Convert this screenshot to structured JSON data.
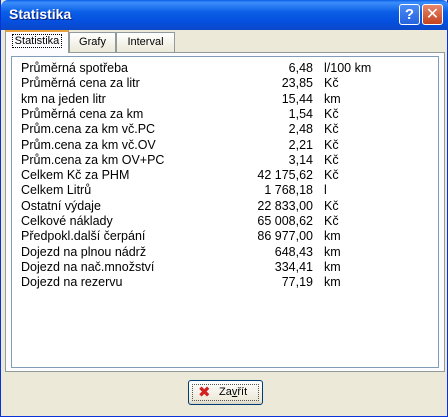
{
  "window": {
    "title": "Statistika"
  },
  "tabs": [
    {
      "label": "Statistika",
      "active": true
    },
    {
      "label": "Grafy",
      "active": false
    },
    {
      "label": "Interval",
      "active": false
    }
  ],
  "stats": [
    {
      "label": "Průměrná spotřeba",
      "value": "6,48",
      "unit": "l/100 km"
    },
    {
      "label": "Průměrná cena za litr",
      "value": "23,85",
      "unit": "Kč"
    },
    {
      "label": "km na jeden litr",
      "value": "15,44",
      "unit": "km"
    },
    {
      "label": "Průměrná cena za km",
      "value": "1,54",
      "unit": "Kč"
    },
    {
      "label": "Prům.cena za km vč.PC",
      "value": "2,48",
      "unit": "Kč"
    },
    {
      "label": "Prům.cena za km vč.OV",
      "value": "2,21",
      "unit": "Kč"
    },
    {
      "label": "Prům.cena za km OV+PC",
      "value": "3,14",
      "unit": "Kč"
    },
    {
      "label": "Celkem Kč za PHM",
      "value": "42 175,62",
      "unit": "Kč"
    },
    {
      "label": "Celkem Litrů",
      "value": "1 768,18",
      "unit": "l"
    },
    {
      "label": "Ostatní výdaje",
      "value": "22 833,00",
      "unit": "Kč"
    },
    {
      "label": "Celkové náklady",
      "value": "65 008,62",
      "unit": "Kč"
    },
    {
      "label": "Předpokl.další čerpání",
      "value": "86 977,00",
      "unit": "km"
    },
    {
      "label": "Dojezd na plnou nádrž",
      "value": "648,43",
      "unit": "km"
    },
    {
      "label": "Dojezd na nač.množství",
      "value": "334,41",
      "unit": "km"
    },
    {
      "label": "Dojezd na rezervu",
      "value": "77,19",
      "unit": "km"
    }
  ],
  "buttons": {
    "close_prefix": "Za",
    "close_accel": "v",
    "close_suffix": "řít"
  },
  "icons": {
    "help": "question-mark",
    "close": "x",
    "close_button": "red-x"
  }
}
